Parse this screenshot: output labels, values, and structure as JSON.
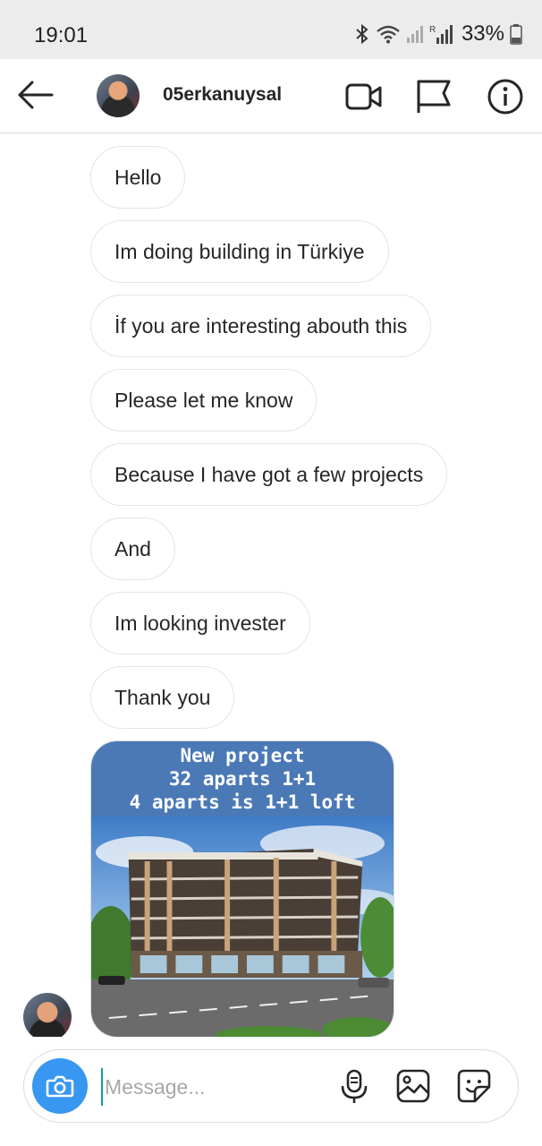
{
  "status_bar": {
    "time": "19:01",
    "battery": "33%",
    "icons": [
      "bluetooth-icon",
      "wifi-icon",
      "signal-icon",
      "roaming-signal-icon",
      "battery-icon"
    ]
  },
  "header": {
    "username": "05erkanuysal",
    "icons": [
      "back-arrow-icon",
      "video-call-icon",
      "flag-icon",
      "info-icon"
    ]
  },
  "messages": [
    "Hello",
    "Im doing building in Türkiye",
    "İf you are interesting abouth this",
    "Please let me know",
    "Because I have got a few projects",
    "And",
    "Im looking invester",
    "Thank you"
  ],
  "photo_message": {
    "caption": [
      "New project",
      "32 aparts 1+1",
      "4 aparts is 1+1 loft"
    ]
  },
  "composer": {
    "placeholder": "Message...",
    "icons": [
      "camera-icon",
      "microphone-icon",
      "gallery-icon",
      "sticker-icon"
    ]
  },
  "colors": {
    "accent": "#3897f0",
    "bubble_border": "#e4e4e4",
    "caption_bg": "#4a79b6"
  }
}
